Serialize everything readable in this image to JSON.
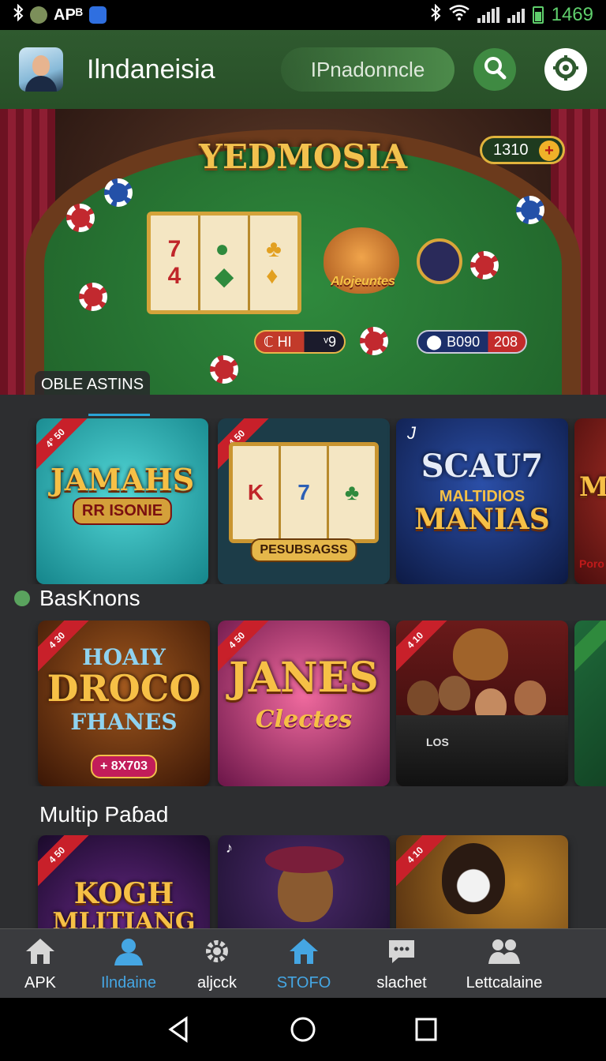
{
  "status_bar": {
    "left_text": "APᴮ",
    "clock": "1469"
  },
  "header": {
    "title": "Ilndaneisia",
    "chip_label": "IPnadonncle",
    "search_icon": "search-icon",
    "settings_icon": "gear-icon"
  },
  "banner": {
    "title": "YEDMOSIA",
    "coin_badge": "1310",
    "coin_plus": "+",
    "lion_text": "Alojeuntes",
    "pill_left_a": "ℂ HI",
    "pill_left_b": "ᵛ9",
    "pill_right_a": "B090",
    "pill_right_b": "208",
    "tag": "OBLE ASTINS"
  },
  "row1": {
    "cards": [
      {
        "ribbon": "4° 50",
        "title": "JAMAHS",
        "subtitle": "RR ISONIE"
      },
      {
        "ribbon": "4 50",
        "reel_symbols": [
          "K",
          "7",
          "♣"
        ],
        "caption": "PESUBSAGSS"
      },
      {
        "badge": "J",
        "title": "SCAU7",
        "subtitle": "MALTIDIOS",
        "title2": "MANIAS"
      },
      {
        "title": "MC",
        "subtitle": "Poro"
      }
    ]
  },
  "section1": {
    "label": "BasKnons"
  },
  "row2": {
    "cards": [
      {
        "ribbon": "4 30",
        "title_top": "HOAIY",
        "title": "DROCO",
        "title_bottom": "FHANES",
        "tag": "+ 8X703"
      },
      {
        "ribbon": "4 50",
        "title": "JANES",
        "subtitle": "Clectes"
      },
      {
        "ribbon": "4 10",
        "caption": "LOS"
      },
      {
        "ribbon": ""
      }
    ]
  },
  "section2": {
    "label": "Multip Paɓad"
  },
  "row3": {
    "cards": [
      {
        "ribbon": "4 50",
        "title": "KOGH",
        "subtitle": "MLITIANG"
      },
      {
        "ribbon": ""
      },
      {
        "ribbon": "4 10"
      }
    ]
  },
  "bottom_nav": {
    "items": [
      {
        "label": "APK",
        "icon": "home-icon"
      },
      {
        "label": "Ilndaine",
        "icon": "user-icon",
        "active": true
      },
      {
        "label": "aljcck",
        "icon": "gear-icon"
      },
      {
        "label": "STOFO",
        "icon": "home-icon",
        "active": true
      },
      {
        "label": "slachet",
        "icon": "chat-icon"
      },
      {
        "label": "Lettcalaine",
        "icon": "group-icon"
      }
    ]
  },
  "colors": {
    "header_bg": "#2f5a2f",
    "accent_blue": "#45a6e3",
    "clock_green": "#5fcf6c",
    "gold": "#f2c14e"
  }
}
